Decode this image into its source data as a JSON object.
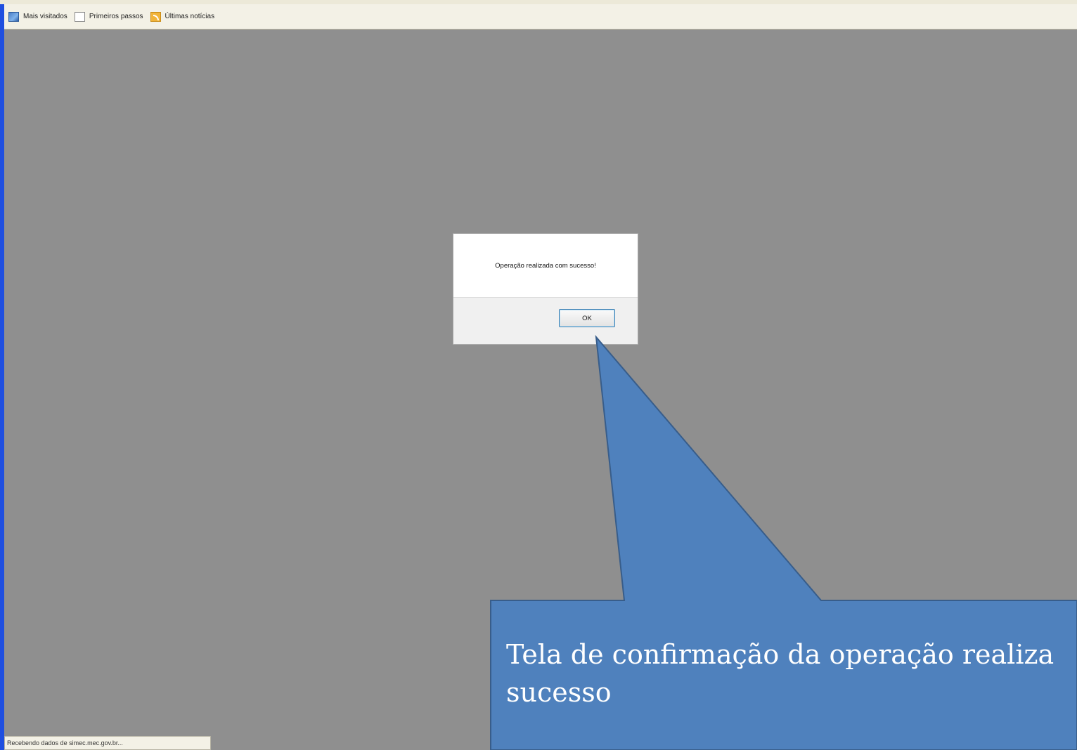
{
  "bookmarks_bar": {
    "items": [
      {
        "label": "Mais visitados",
        "icon": "most-visited-icon"
      },
      {
        "label": "Primeiros passos",
        "icon": "page-icon"
      },
      {
        "label": "Últimas notícias",
        "icon": "rss-feed-icon"
      }
    ]
  },
  "dialog": {
    "message": "Operação realizada com sucesso!",
    "ok_label": "OK"
  },
  "callout": {
    "line1": "Tela de confirmação da operação realiza",
    "line2": "sucesso",
    "fill_color": "#4f81bd",
    "stroke_color": "#385d8a"
  },
  "status_bar": {
    "text": "Recebendo dados de simec.mec.gov.br..."
  },
  "colors": {
    "overlay": "#8f8f8f",
    "window_edge": "#1f4fe0"
  }
}
